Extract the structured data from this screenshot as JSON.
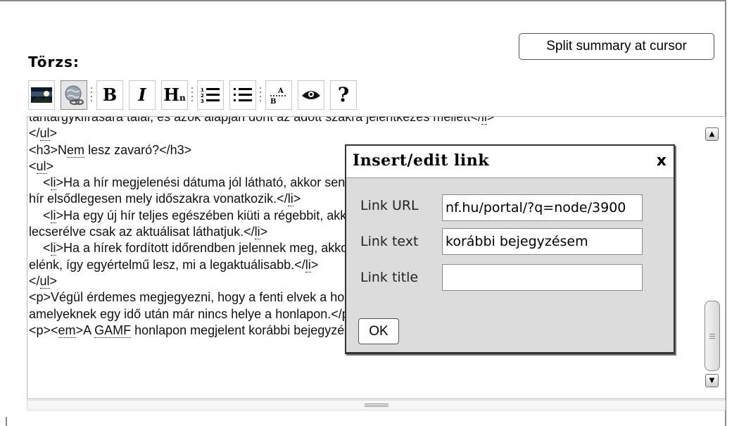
{
  "split_button_label": "Split summary at cursor",
  "field_label": "Törzs:",
  "toolbar": {
    "bold_glyph": "B",
    "italic_glyph": "I",
    "heading_glyph": "H",
    "heading_sub": "n",
    "help_glyph": "?"
  },
  "editor_lines": [
    "tantárgykiírására talál, és azok alapján dönt az adott szakra jelentkezés mellett</li>",
    "</ul>",
    "<h3>Nem lesz zavaró?</h3>",
    "<ul>",
    "    <li>Ha a hír megjelenési dátuma jól látható, akkor senki számára nem lesz kérdéses, hogy a",
    "hír elsődlegesen mely időszakra vonatkozik.</li>",
    "    <li>Ha egy új hír teljes egészében kiüti a régebbit, akkor a régi információkat",
    "lecserélve csak az aktuálisat láthatjuk.</li>",
    "    <li>Ha a hírek fordított időrendben jelennek meg, akkor a legfrissebb hírek kerülnek",
    "elénk, így egyértelmű lesz, mi a legaktuálisabb.</li>",
    "</ul>",
    "<p>Végül érdemes megjegyezni, hogy a fenti elvek a honlap minden hírére vonatkoznak,",
    "amelyeknek egy idő után már nincs helye a honlapon.</p>",
    "<p><em>A GAMF honlapon megjelent korábbi bejegyzésem alapján</em></p>"
  ],
  "scrollbar": {
    "up_glyph": "▲",
    "down_glyph": "▼"
  },
  "dialog": {
    "title": "Insert/edit link",
    "close_glyph": "x",
    "url_label": "Link URL",
    "url_value": "nf.hu/portal/?q=node/3900",
    "text_label": "Link text",
    "text_value": "korábbi bejegyzésem",
    "title_label": "Link title",
    "title_value": "",
    "ok_label": "OK"
  }
}
